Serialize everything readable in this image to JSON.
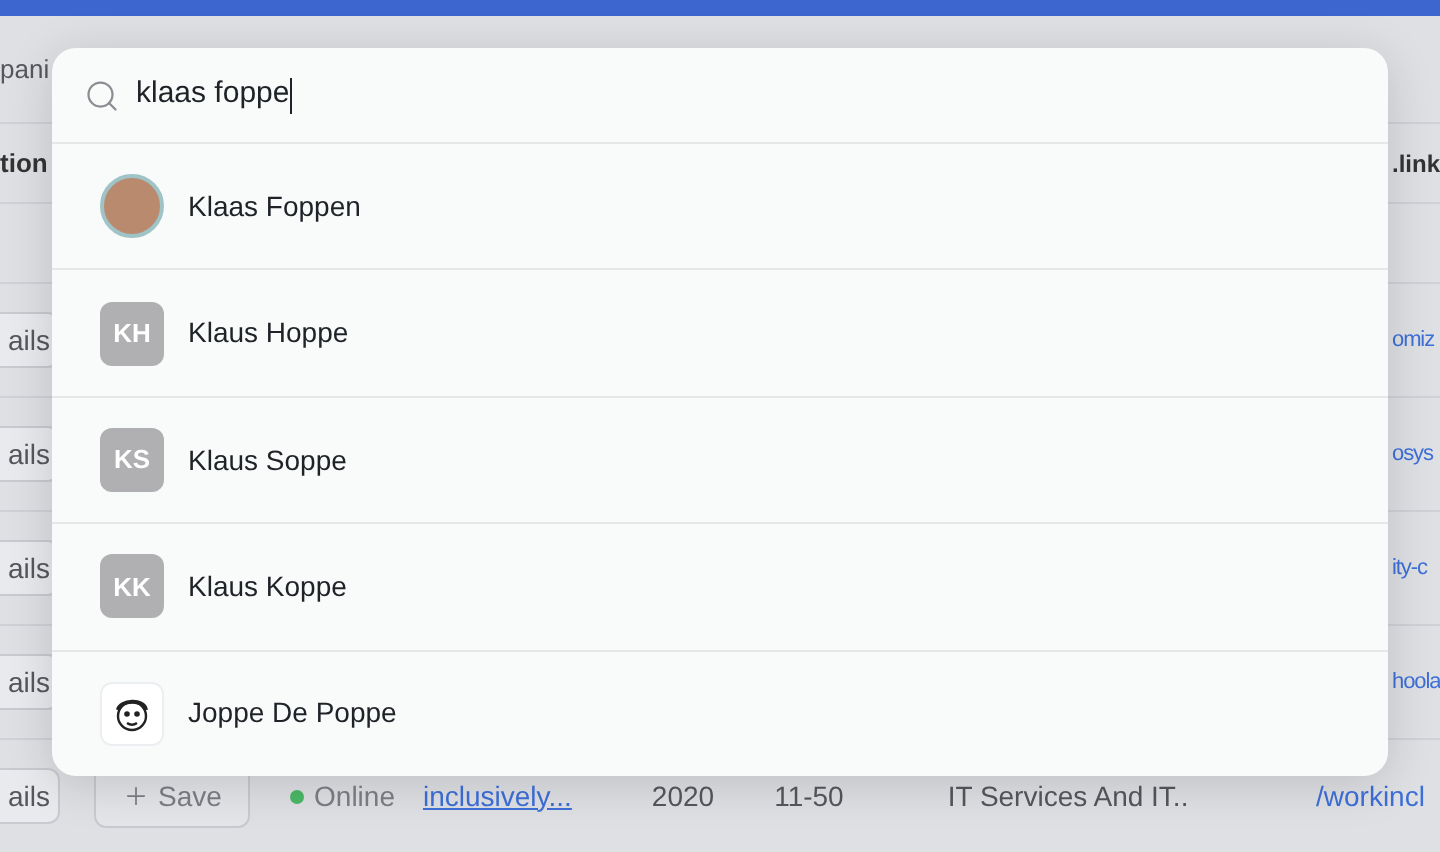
{
  "background": {
    "toolbar_text": "pani",
    "header": {
      "column_1": "tion",
      "column_last": ".link"
    },
    "rows": [
      {
        "kind": "link",
        "column_1": "ails",
        "link": "omiz"
      },
      {
        "kind": "link",
        "column_1": "ails",
        "link": "osys"
      },
      {
        "kind": "link",
        "column_1": "ails",
        "link": "ity-c"
      },
      {
        "kind": "link",
        "column_1": "ails",
        "link": "hoola"
      },
      {
        "kind": "full",
        "column_1": "ails",
        "save": "Save",
        "status": "Online",
        "website": "inclusively...",
        "founded": "2020",
        "size": "11-50",
        "industry": "IT Services And IT..",
        "link": "/workincl"
      }
    ]
  },
  "search": {
    "value": "klaas foppe"
  },
  "results": [
    {
      "kind": "photo",
      "name": "Klaas Foppen"
    },
    {
      "kind": "initials",
      "initials": "KH",
      "name": "Klaus Hoppe"
    },
    {
      "kind": "initials",
      "initials": "KS",
      "name": "Klaus Soppe"
    },
    {
      "kind": "initials",
      "initials": "KK",
      "name": "Klaus Koppe"
    },
    {
      "kind": "drawing",
      "name": "Joppe De Poppe"
    }
  ]
}
